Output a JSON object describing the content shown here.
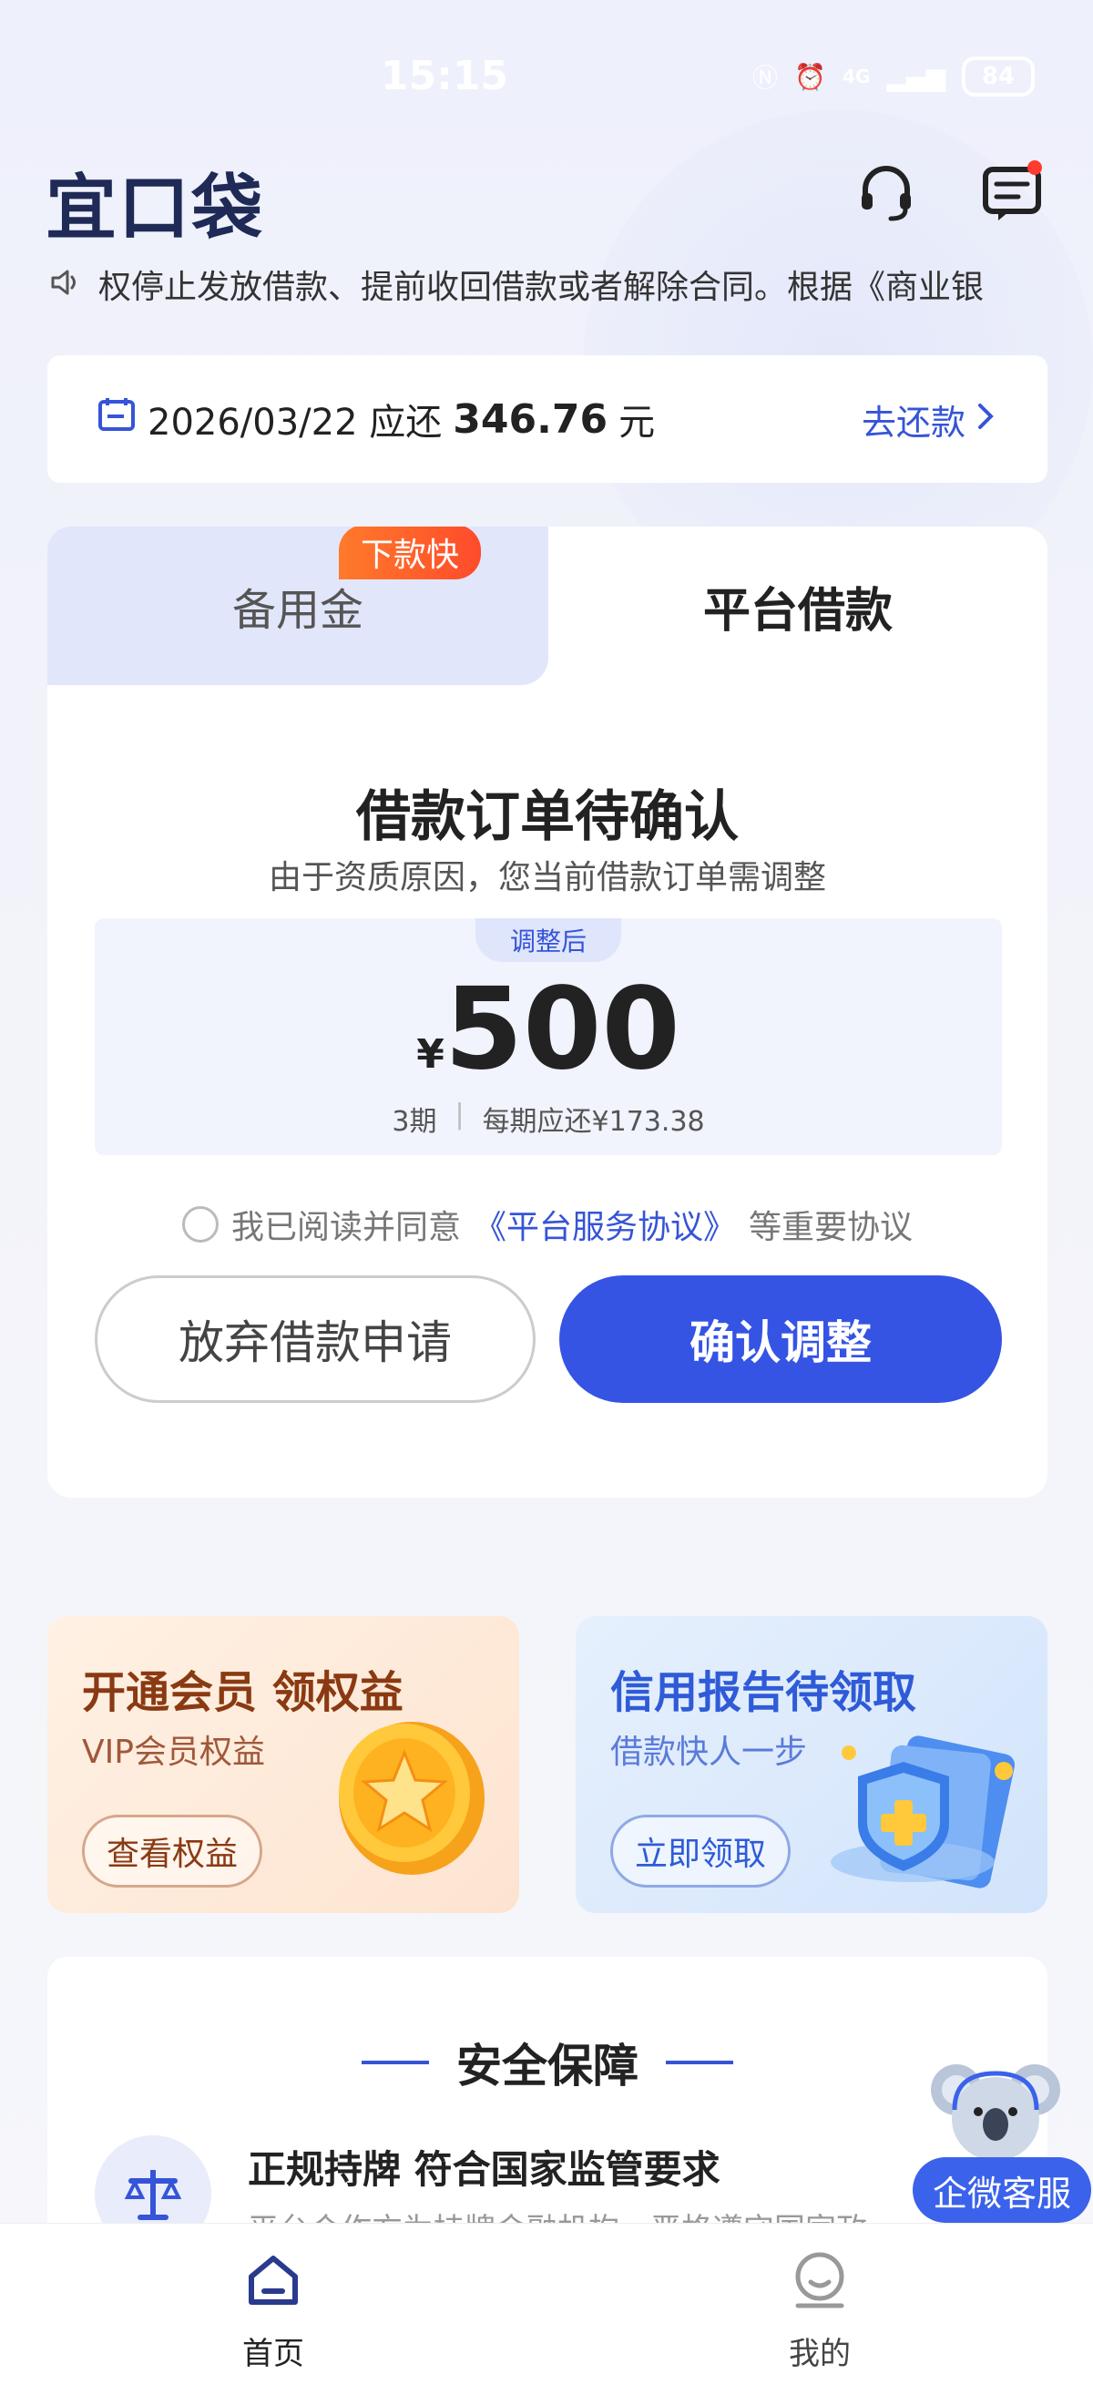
{
  "status_bar": {
    "time": "15:15",
    "network": "4G",
    "battery": "84"
  },
  "header": {
    "logo": "宜口袋",
    "icons": [
      "headset-icon",
      "message-icon"
    ],
    "notification_dot_color": "#ff3b30"
  },
  "notice": {
    "text": "权停止发放借款、提前收回借款或者解除合同。根据《商业银"
  },
  "repayment_banner": {
    "date_text": "2026/03/22 应还",
    "amount": "346.76",
    "unit": "元",
    "action": "去还款"
  },
  "loan_card": {
    "tabs": [
      {
        "label": "备用金",
        "active": false
      },
      {
        "label": "平台借款",
        "active": true
      }
    ],
    "badge": "下款快",
    "title": "借款订单待确认",
    "subtitle": "由于资质原因，您当前借款订单需调整",
    "adjusted_tag": "调整后",
    "currency": "¥",
    "amount": "500",
    "term": "3期",
    "per_period": "每期应还¥173.38",
    "agreement_prefix": "我已阅读并同意",
    "agreement_link": "《平台服务协议》",
    "agreement_suffix": "等重要协议",
    "abandon_button": "放弃借款申请",
    "confirm_button": "确认调整"
  },
  "promos": [
    {
      "title": "开通会员 领权益",
      "subtitle": "VIP会员权益",
      "button": "查看权益",
      "accent": "#8a3a12"
    },
    {
      "title": "信用报告待领取",
      "subtitle": "借款快人一步",
      "button": "立即领取",
      "accent": "#2f5bd8"
    }
  ],
  "safety": {
    "title": "安全保障",
    "item_title": "正规持牌 符合国家监管要求",
    "item_desc": "平台合作方为持牌金融机构，严格遵守国家政"
  },
  "customer_service": {
    "label": "企微客服"
  },
  "bottom_nav": [
    {
      "label": "首页",
      "active": true,
      "icon": "home-icon"
    },
    {
      "label": "我的",
      "active": false,
      "icon": "profile-icon"
    }
  ],
  "colors": {
    "primary": "#3554e4",
    "badge": "#ff5a2b"
  }
}
